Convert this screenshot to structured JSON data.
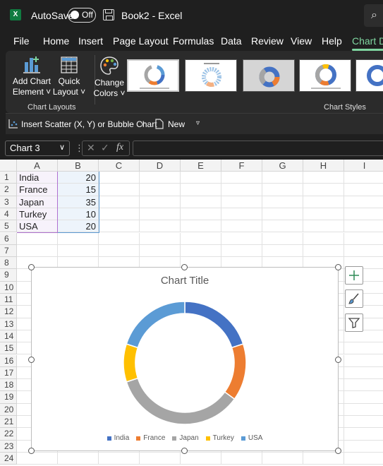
{
  "titlebar": {
    "app_icon": "excel-logo-icon",
    "autosave_label": "AutoSave",
    "autosave_state": "Off",
    "document_title": "Book2 - Excel"
  },
  "menu": {
    "tabs": [
      "File",
      "Home",
      "Insert",
      "Page Layout",
      "Formulas",
      "Data",
      "Review",
      "View",
      "Help",
      "Chart De"
    ],
    "active_tab": "Chart De"
  },
  "ribbon": {
    "add_chart_element": [
      "Add Chart",
      "Element ˅"
    ],
    "quick_layout": [
      "Quick",
      "Layout ˅"
    ],
    "change_colors": [
      "Change",
      "Colors ˅"
    ],
    "group_chart_layouts": "Chart Layouts",
    "group_chart_styles": "Chart Styles",
    "accent_color": "#7fd6a0"
  },
  "commandbar": {
    "insert_scatter": "Insert Scatter (X, Y) or Bubble Chart",
    "new_label": "New"
  },
  "formula": {
    "namebox": "Chart 3",
    "fx_label": "fx"
  },
  "grid": {
    "columns": [
      "A",
      "B",
      "C",
      "D",
      "E",
      "F",
      "G",
      "H",
      "I"
    ],
    "rows": [
      "1",
      "2",
      "3",
      "4",
      "5",
      "6",
      "7",
      "8",
      "9",
      "10",
      "11",
      "12",
      "13",
      "14",
      "15",
      "16",
      "17",
      "18",
      "19",
      "20",
      "21",
      "22",
      "23",
      "24"
    ],
    "data": [
      {
        "a": "India",
        "b": "20"
      },
      {
        "a": "France",
        "b": "15"
      },
      {
        "a": "Japan",
        "b": "35"
      },
      {
        "a": "Turkey",
        "b": "10"
      },
      {
        "a": "USA",
        "b": "20"
      }
    ]
  },
  "chart_data": {
    "type": "pie",
    "variant": "doughnut",
    "title": "Chart Title",
    "categories": [
      "India",
      "France",
      "Japan",
      "Turkey",
      "USA"
    ],
    "values": [
      20,
      15,
      35,
      10,
      20
    ],
    "colors": [
      "#4472c4",
      "#ed7d31",
      "#a5a5a5",
      "#ffc000",
      "#5b9bd5"
    ],
    "legend_position": "bottom"
  }
}
